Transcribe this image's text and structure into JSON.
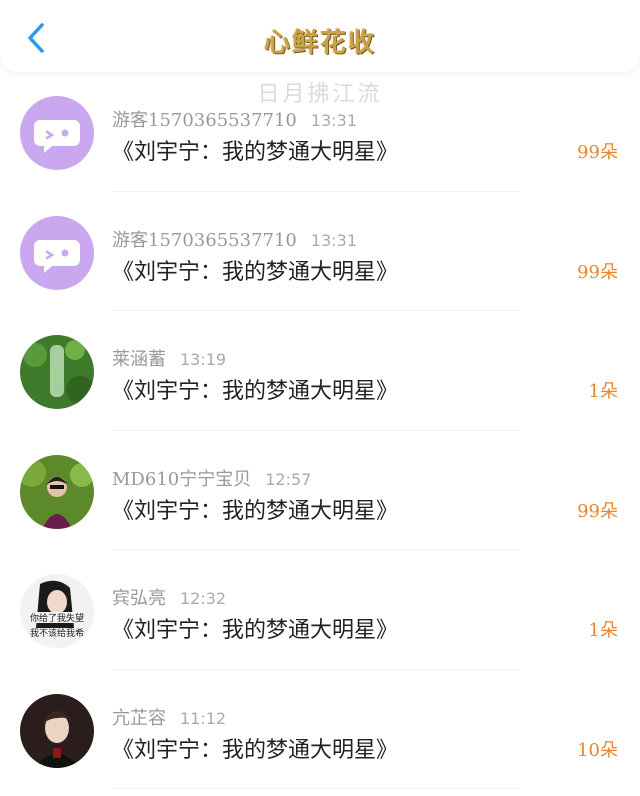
{
  "header": {
    "title": "心鲜花收",
    "back_icon": "chevron-left-icon",
    "accent": "#2a9af3"
  },
  "watermark": "日月拂江流",
  "items": [
    {
      "user": "游客1570365537710",
      "time": "13:31",
      "song": "《刘宇宁：我的梦通大明星》",
      "count": "99朵",
      "avatar": "chat-bubble-avatar"
    },
    {
      "user": "游客1570365537710",
      "time": "13:31",
      "song": "《刘宇宁：我的梦通大明星》",
      "count": "99朵",
      "avatar": "chat-bubble-avatar"
    },
    {
      "user": "莱涵蓄",
      "time": "13:19",
      "song": "《刘宇宁：我的梦通大明星》",
      "count": "1朵",
      "avatar": "plant-photo-avatar"
    },
    {
      "user": "MD610宁宁宝贝",
      "time": "12:57",
      "song": "《刘宇宁：我的梦通大明星》",
      "count": "99朵",
      "avatar": "person-photo-avatar"
    },
    {
      "user": "宾弘亮",
      "time": "12:32",
      "song": "《刘宇宁：我的梦通大明星》",
      "count": "1朵",
      "avatar": "meme-photo-avatar",
      "avatar_text": [
        "你给了我失望",
        "我不该给我希"
      ]
    },
    {
      "user": "亢芷容",
      "time": "11:12",
      "song": "《刘宇宁：我的梦通大明星》",
      "count": "10朵",
      "avatar": "anime-character-avatar"
    }
  ]
}
